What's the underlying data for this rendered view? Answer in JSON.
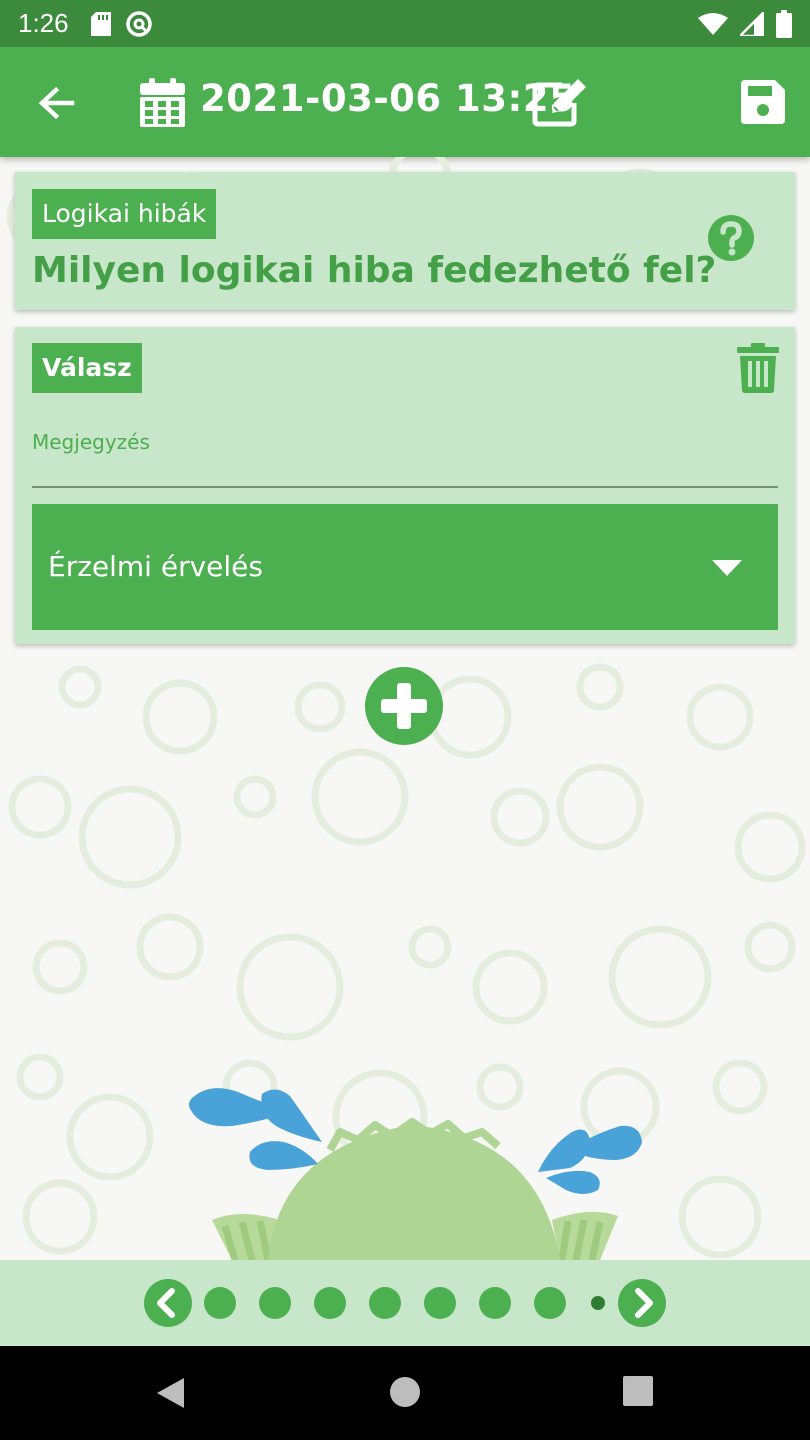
{
  "status_bar": {
    "time": "1:26"
  },
  "app_bar": {
    "datetime": "2021-03-06 13:25"
  },
  "question_card": {
    "tag": "Logikai hibák",
    "question": "Milyen logikai hiba fedezhető fel?"
  },
  "answer_card": {
    "tag": "Válasz",
    "note_label": "Megjegyzés",
    "note_value": "",
    "dropdown_value": "Érzelmi érvelés"
  },
  "pager": {
    "page_count": 8,
    "current_index": 7
  },
  "colors": {
    "primary": "#4caf50",
    "primary_dark": "#3c8a3c",
    "card_bg": "#c8e6c9",
    "accent_text": "#43a047",
    "drop_blue": "#4aa3d8"
  },
  "icons": {
    "back": "arrow-left-icon",
    "calendar": "calendar-icon",
    "edit": "edit-icon",
    "save": "floppy-save-icon",
    "help": "question-circle-icon",
    "delete": "trash-icon",
    "add": "plus-circle-icon",
    "prev": "chevron-left-icon",
    "next": "chevron-right-icon"
  }
}
